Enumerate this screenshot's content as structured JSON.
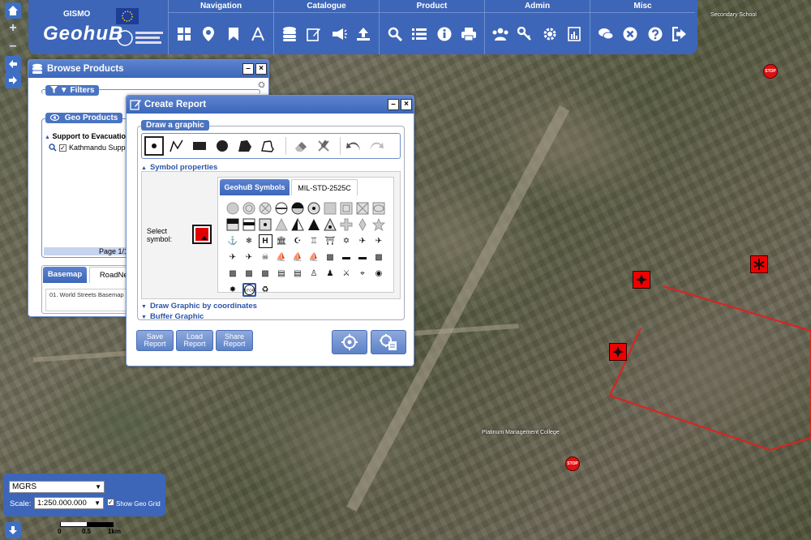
{
  "banner": {
    "brand_small": "GISMO",
    "brand": "GeohuB"
  },
  "nav": [
    {
      "title": "Navigation",
      "icons": [
        "layers-grid-icon",
        "map-marker-icon",
        "bookmark-icon",
        "measure-compass-icon"
      ]
    },
    {
      "title": "Catalogue",
      "icons": [
        "database-icon",
        "edit-document-icon",
        "announce-icon",
        "upload-icon"
      ]
    },
    {
      "title": "Product",
      "icons": [
        "search-icon",
        "list-icon",
        "info-icon",
        "print-icon"
      ]
    },
    {
      "title": "Admin",
      "icons": [
        "users-icon",
        "key-icon",
        "settings-gear-icon",
        "report-chart-icon"
      ]
    },
    {
      "title": "Misc",
      "icons": [
        "chat-icon",
        "close-circle-icon",
        "help-icon",
        "logout-icon"
      ]
    }
  ],
  "browse": {
    "title": "Browse Products",
    "filters": "Filters",
    "geo_products": "Geo Products",
    "tree_root": "Support to Evacuation P",
    "tree_child": "Kathmandu Suppo",
    "page": "Page 1/1",
    "tabs": [
      "Basemap",
      "RoadNetw"
    ],
    "basemap_item": "01. World Streets Basemap"
  },
  "create": {
    "title": "Create Report",
    "draw_legend": "Draw a graphic",
    "symbol_props": "Symbol properties",
    "tabs": [
      "GeohuB Symbols",
      "MIL-STD-2525C"
    ],
    "select_symbol": "Select symbol:",
    "draw_coords": "Draw Graphic by coordinates",
    "buffer": "Buffer Graphic",
    "buttons": [
      {
        "l1": "Save",
        "l2": "Report"
      },
      {
        "l1": "Load",
        "l2": "Report"
      },
      {
        "l1": "Share",
        "l2": "Report"
      }
    ]
  },
  "map": {
    "labels": [
      "Platinum Management College",
      "Secondary School"
    ],
    "stop": "STOP"
  },
  "coords": {
    "system": "MGRS",
    "scale_label": "Scale:",
    "scale": "1:250.000.000",
    "geo_grid": "Show Geo Grid",
    "scalebar": [
      "0",
      "0.5",
      "1km"
    ]
  },
  "colors": {
    "accent": "#3d66b8",
    "hazard": "#e00000",
    "polygon": "#e02020"
  }
}
